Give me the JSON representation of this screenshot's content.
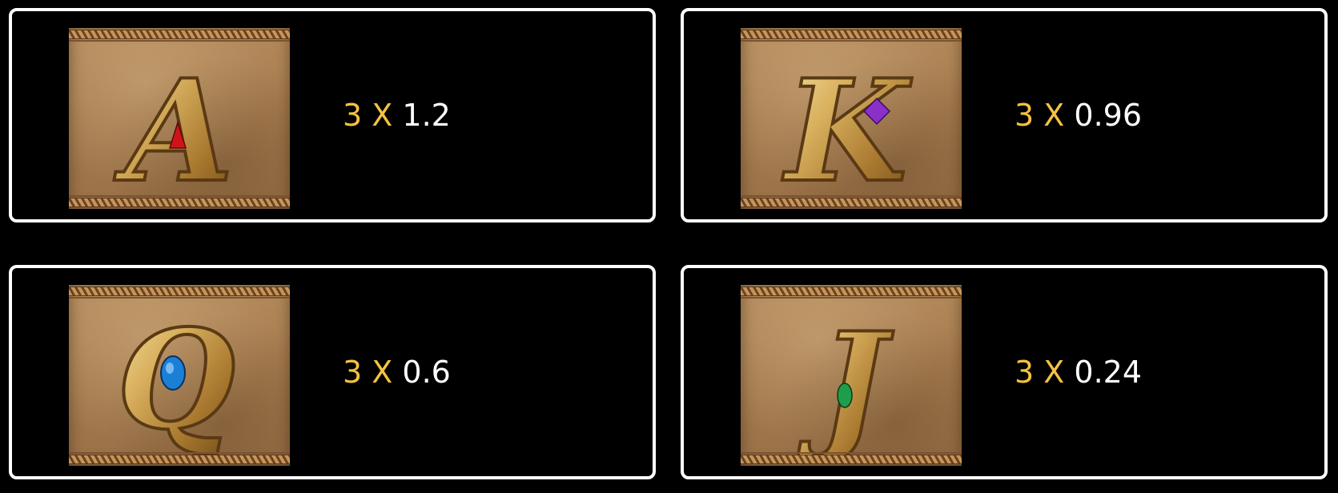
{
  "colors": {
    "background": "#000000",
    "card_border": "#ffffff",
    "count_color": "#f5c242",
    "multiplier_color": "#ffffff",
    "tile_color": "#a67c50",
    "letter_gold": "#d9b15f"
  },
  "paytable": [
    {
      "symbol": "A",
      "gem_color": "#d0151a",
      "count": "3",
      "times": "X",
      "multiplier": "1.2"
    },
    {
      "symbol": "K",
      "gem_color": "#8a2fc8",
      "count": "3",
      "times": "X",
      "multiplier": "0.96"
    },
    {
      "symbol": "Q",
      "gem_color": "#1c7fd6",
      "count": "3",
      "times": "X",
      "multiplier": "0.6"
    },
    {
      "symbol": "J",
      "gem_color": "#1e9e4a",
      "count": "3",
      "times": "X",
      "multiplier": "0.24"
    }
  ]
}
